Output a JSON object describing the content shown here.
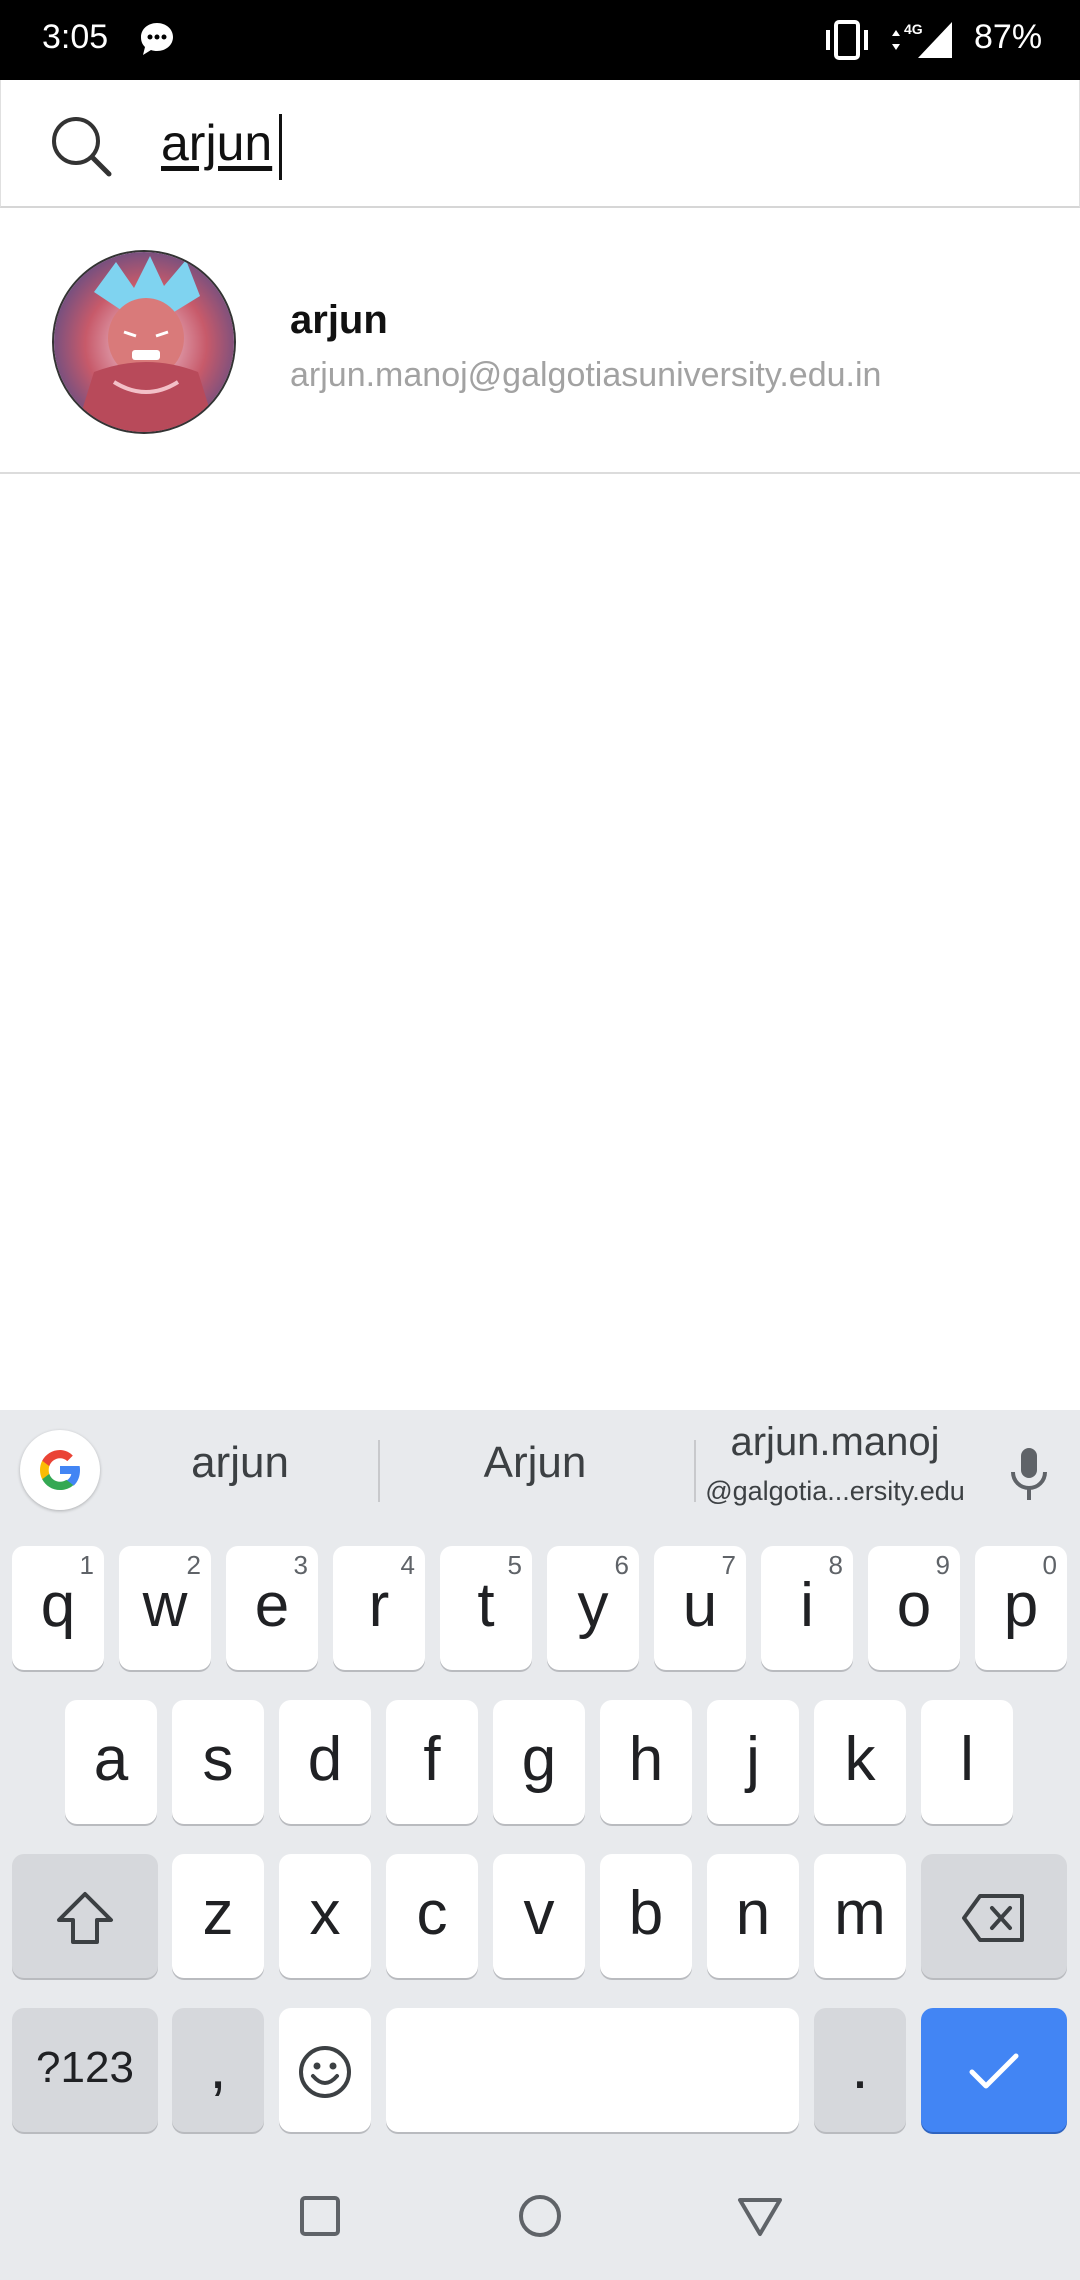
{
  "status_bar": {
    "time": "3:05",
    "network": "4G",
    "battery": "87%",
    "icons": [
      "message-icon",
      "vibrate-icon",
      "data-arrows-icon",
      "signal-icon"
    ]
  },
  "search": {
    "query": "arjun",
    "icon": "search-icon"
  },
  "results": [
    {
      "name": "arjun",
      "email": "arjun.manoj@galgotiasuniversity.edu.in",
      "avatar": "avatar-image"
    }
  ],
  "keyboard": {
    "suggestions": {
      "first": "arjun",
      "second": "Arjun",
      "third_main": "arjun.manoj",
      "third_sub": "@galgotia...ersity.edu"
    },
    "row1": [
      {
        "key": "q",
        "hint": "1"
      },
      {
        "key": "w",
        "hint": "2"
      },
      {
        "key": "e",
        "hint": "3"
      },
      {
        "key": "r",
        "hint": "4"
      },
      {
        "key": "t",
        "hint": "5"
      },
      {
        "key": "y",
        "hint": "6"
      },
      {
        "key": "u",
        "hint": "7"
      },
      {
        "key": "i",
        "hint": "8"
      },
      {
        "key": "o",
        "hint": "9"
      },
      {
        "key": "p",
        "hint": "0"
      }
    ],
    "row2": [
      "a",
      "s",
      "d",
      "f",
      "g",
      "h",
      "j",
      "k",
      "l"
    ],
    "row3": [
      "z",
      "x",
      "c",
      "v",
      "b",
      "n",
      "m"
    ],
    "bottom": {
      "symbols": "?123",
      "comma": ",",
      "period": "."
    },
    "accent_color": "#4285f4"
  }
}
